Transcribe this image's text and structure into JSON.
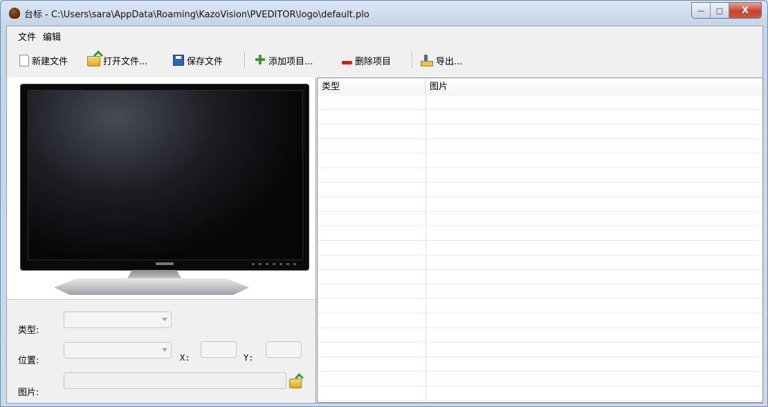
{
  "window": {
    "title": "台标 - C:\\Users\\sara\\AppData\\Roaming\\KazoVision\\PVEDITOR\\logo\\default.plo",
    "minimize": "—",
    "maximize": "□",
    "close": "X"
  },
  "menu": [
    "文件",
    "编辑"
  ],
  "toolbar": {
    "new_file": "新建文件",
    "open_file": "打开文件...",
    "save_file": "保存文件",
    "add_item": "添加项目...",
    "delete_item": "删除项目",
    "export": "导出..."
  },
  "form": {
    "type_label": "类型:",
    "position_label": "位置:",
    "x_label": "X:",
    "y_label": "Y:",
    "image_label": "图片:",
    "type_value": "",
    "position_value": "",
    "x_value": "",
    "y_value": "",
    "image_value": ""
  },
  "list": {
    "columns": [
      "类型",
      "图片"
    ],
    "rows": []
  },
  "icons": {
    "app": "app-logo-icon",
    "new": "new-file-icon",
    "open": "open-folder-icon",
    "save": "save-disk-icon",
    "add": "plus-icon",
    "delete": "minus-icon",
    "export": "export-icon",
    "browse": "browse-folder-icon"
  }
}
